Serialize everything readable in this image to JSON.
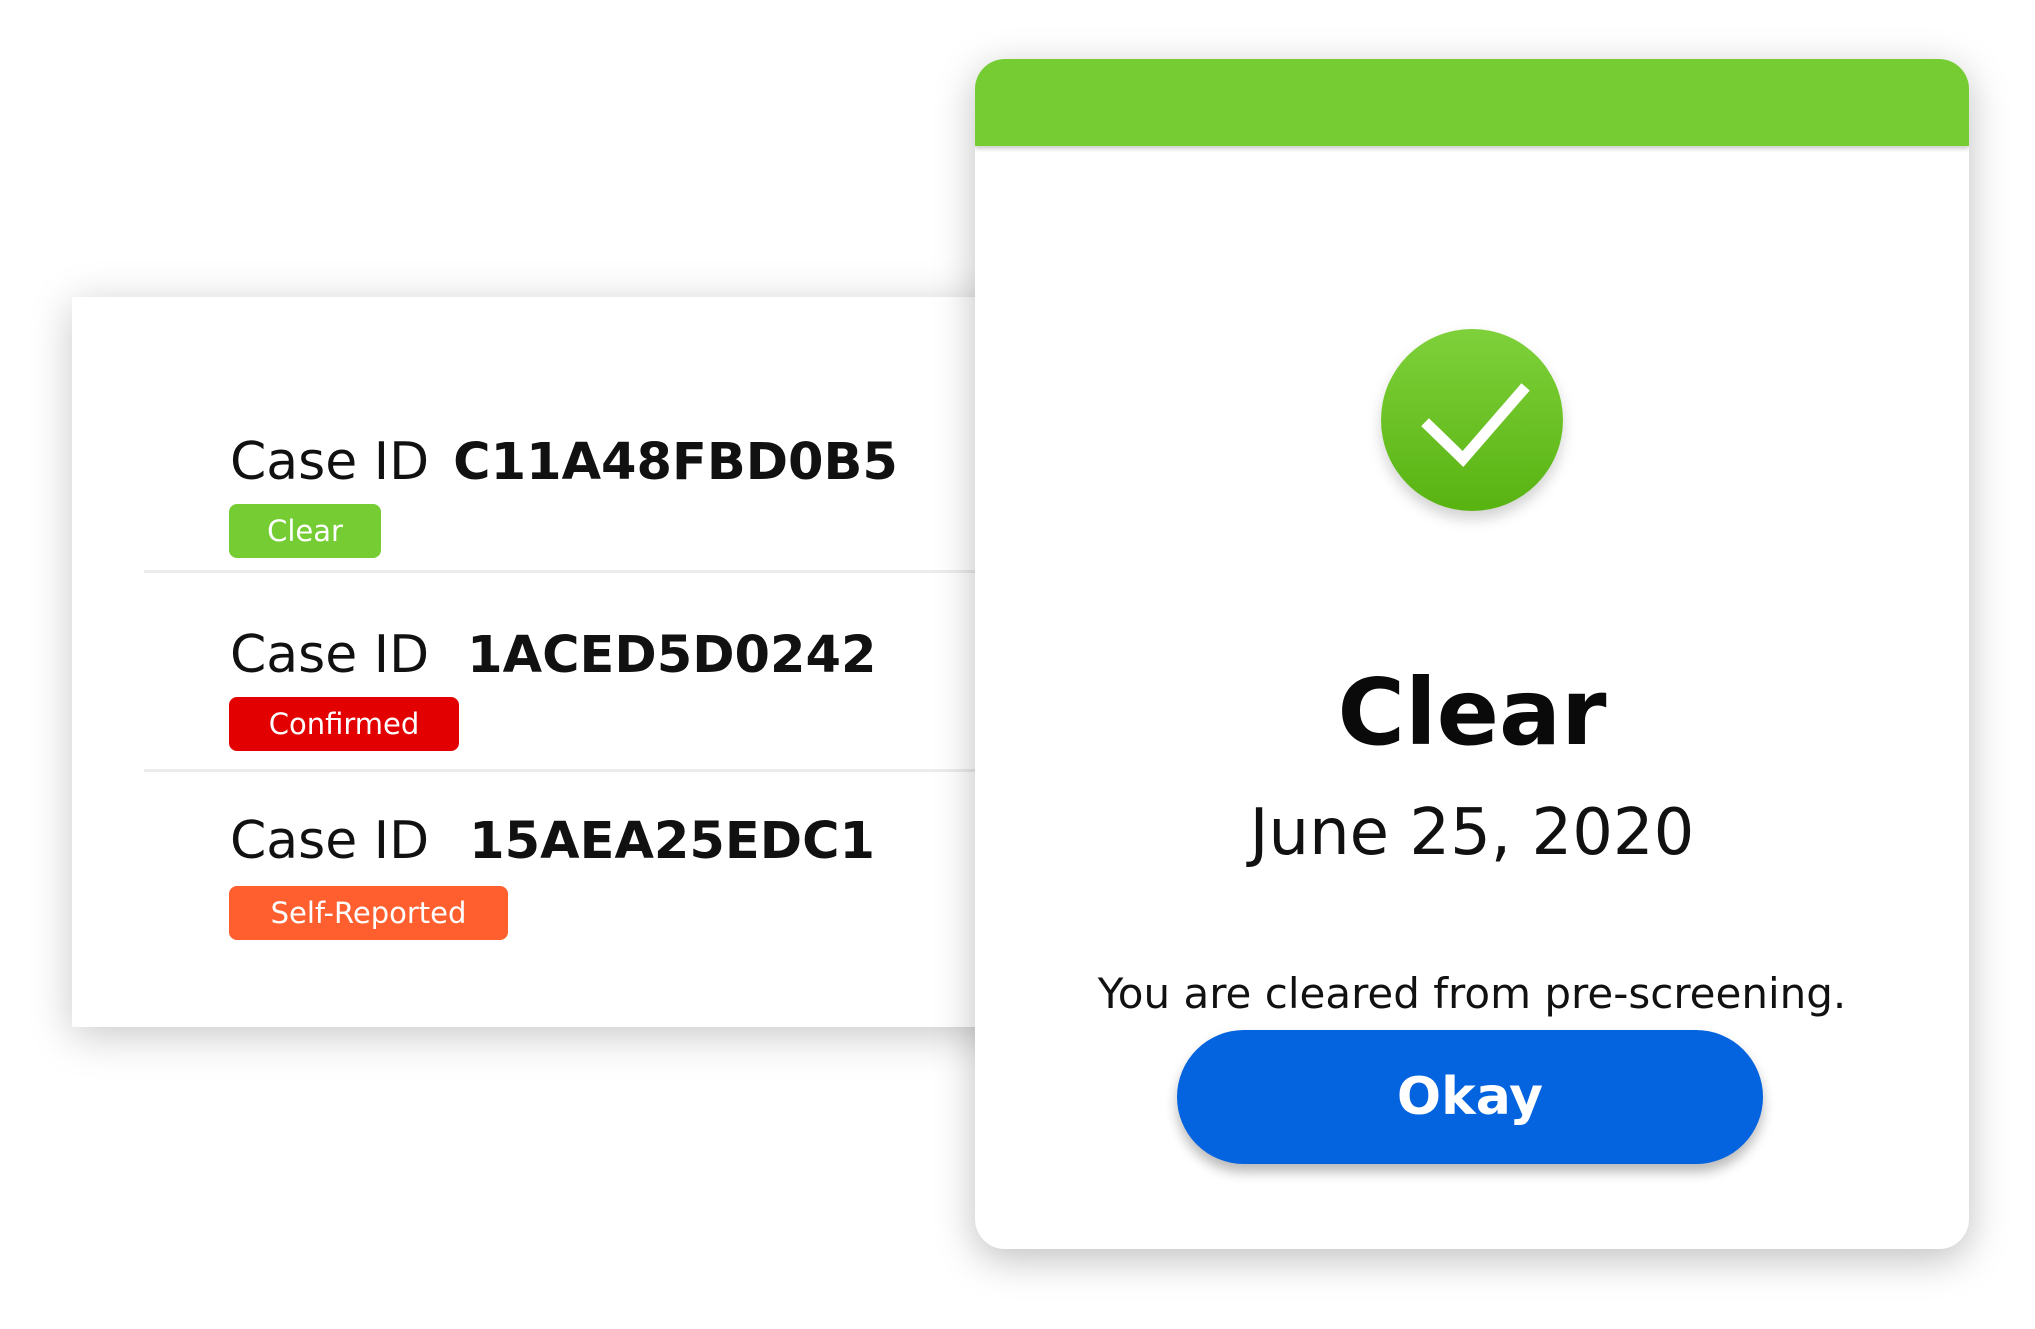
{
  "cases": [
    {
      "label": "Case ID",
      "id": "C11A48FBD0B5",
      "status": "Clear",
      "status_color": "#76cc33"
    },
    {
      "label": "Case ID",
      "id": "1ACED5D0242",
      "status": "Confirmed",
      "status_color": "#e30000"
    },
    {
      "label": "Case ID",
      "id": "15AEA25EDC1",
      "status": "Self-Reported",
      "status_color": "#ff5f2e"
    }
  ],
  "modal": {
    "header_color": "#75cd33",
    "icon": "checkmark-icon",
    "title": "Clear",
    "date": "June 25, 2020",
    "message": "You are cleared from pre-screening.",
    "button_label": "Okay",
    "button_color": "#0463df"
  }
}
